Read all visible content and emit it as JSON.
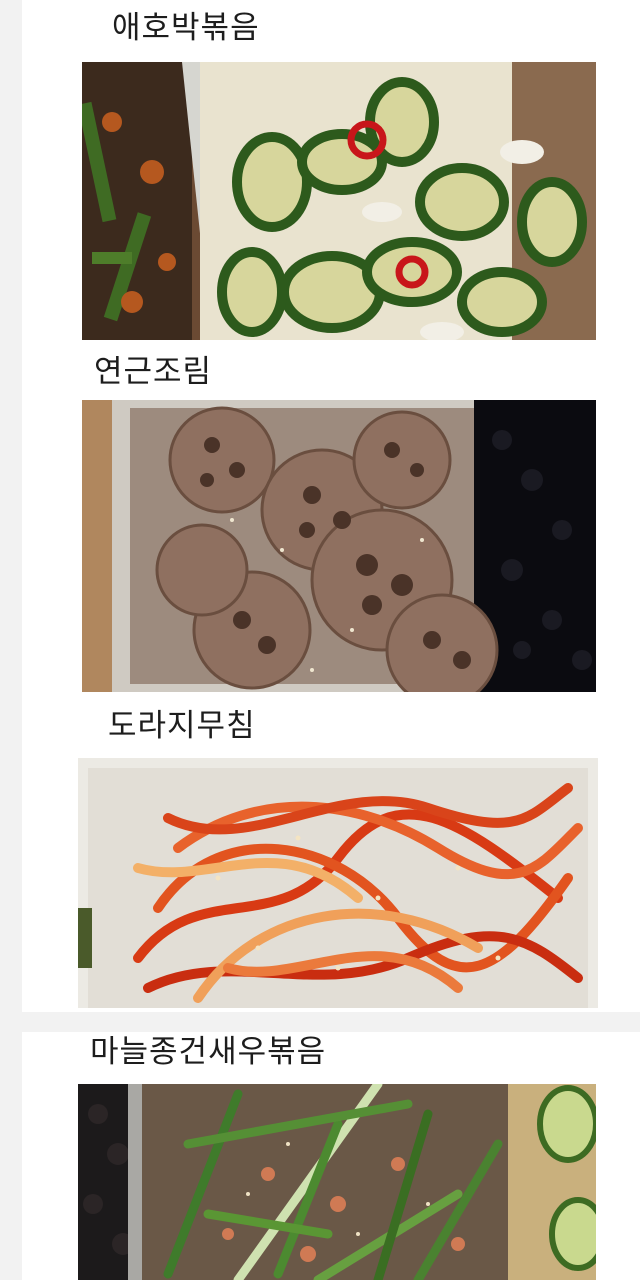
{
  "posts": [
    {
      "title": "애호박볶음",
      "image": "zucchini-stir-fry-photo"
    },
    {
      "title": "연근조림",
      "image": "braised-lotus-root-photo"
    },
    {
      "title": "도라지무침",
      "image": "seasoned-bellflower-root-photo"
    },
    {
      "title": "마늘종건새우볶음",
      "image": "garlic-scape-dried-shrimp-photo"
    }
  ]
}
